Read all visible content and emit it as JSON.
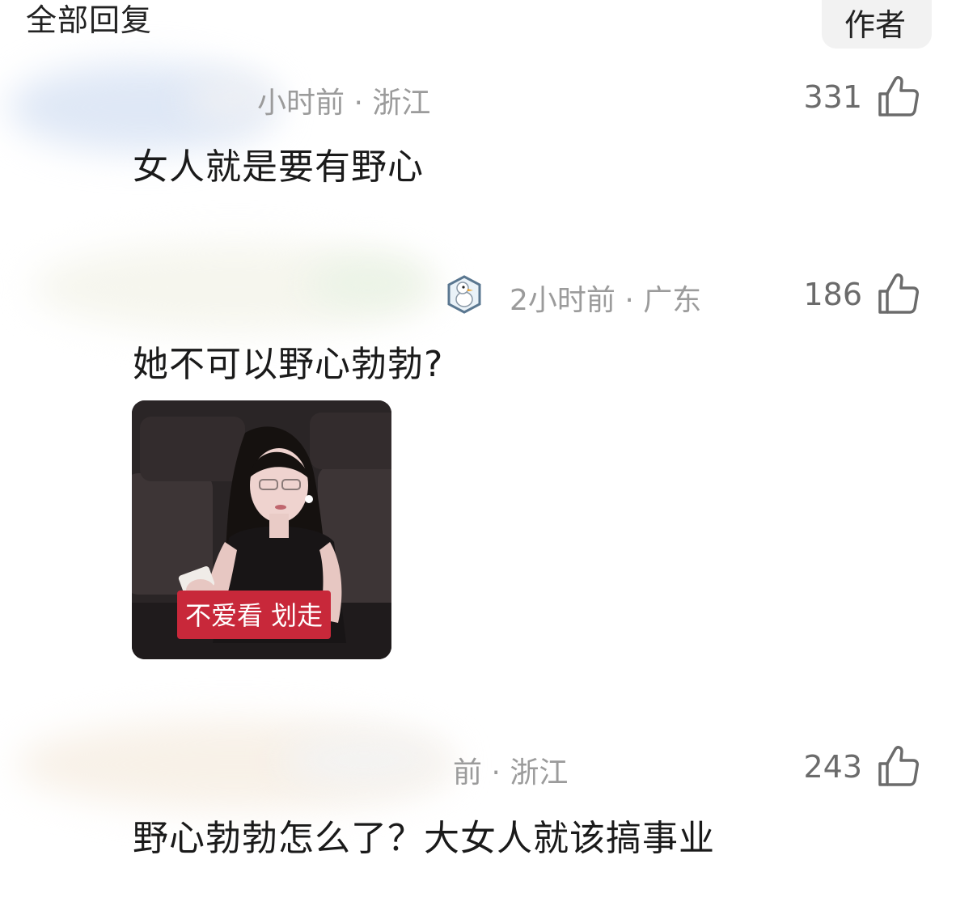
{
  "header": {
    "title": "全部回复",
    "author_tab": "作者"
  },
  "comments": [
    {
      "meta": "小时前 · 浙江",
      "likes": "331",
      "text": "女人就是要有野心"
    },
    {
      "meta": "2小时前 · 广东",
      "likes": "186",
      "text": "她不可以野心勃勃?",
      "sticker_caption": "不爱看 划走"
    },
    {
      "meta": "前 · 浙江",
      "likes": "243",
      "text": "野心勃勃怎么了？大女人就该搞事业"
    }
  ],
  "icons": {
    "like": "thumbs-up-icon",
    "badge": "goose-avatar-badge-icon"
  },
  "colors": {
    "text_primary": "#1a1a1a",
    "text_meta": "#9b9b9b",
    "likes": "#6b6b6b",
    "sticker_caption_bg": "#c8283a"
  }
}
